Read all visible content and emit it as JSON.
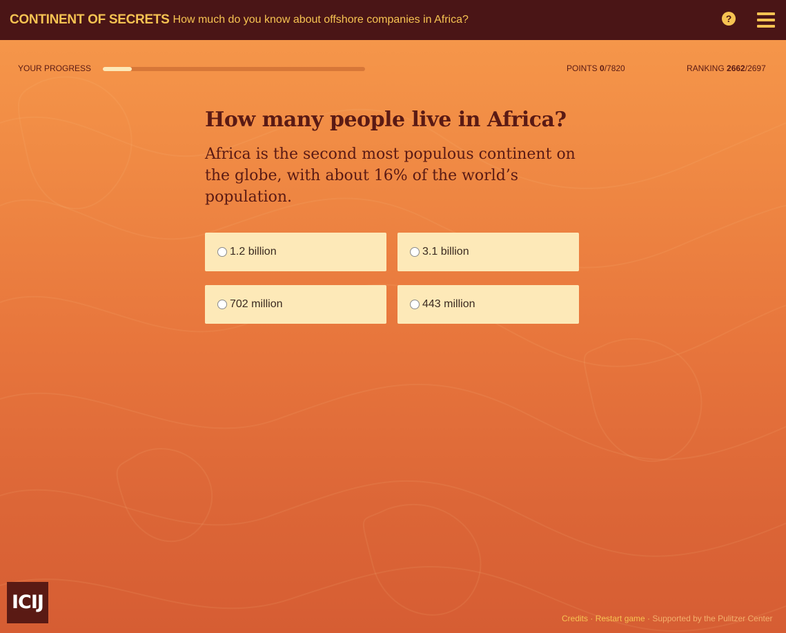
{
  "header": {
    "brand": "CONTINENT OF SECRETS",
    "tagline": "How much do you know about offshore companies in Africa?",
    "help_icon": "question-circle-icon",
    "help_glyph": "?",
    "menu_icon": "hamburger-menu-icon"
  },
  "status": {
    "progress_label": "YOUR PROGRESS",
    "progress_fraction": 0.11,
    "points_label": "POINTS",
    "points_value": "0",
    "points_total": "/7820",
    "ranking_label": "RANKING",
    "ranking_value": "2662",
    "ranking_total": "/2697"
  },
  "question": {
    "title": "How many people live in Africa?",
    "explanation": "Africa is the second most populous continent on the globe, with about 16% of the world’s population."
  },
  "answers": [
    {
      "label": "1.2 billion"
    },
    {
      "label": "3.1 billion"
    },
    {
      "label": "702 million"
    },
    {
      "label": "443 million"
    }
  ],
  "footer": {
    "logo_text": "ICIJ",
    "credits": "Credits",
    "sep1": " · ",
    "restart": "Restart game",
    "sep2": " · ",
    "supported": "Supported by the Pulitzer Center"
  },
  "colors": {
    "header_bg": "#4a1516",
    "accent": "#f6c352",
    "answer_bg": "#fde9b8",
    "text_dark": "#5a1a14"
  }
}
